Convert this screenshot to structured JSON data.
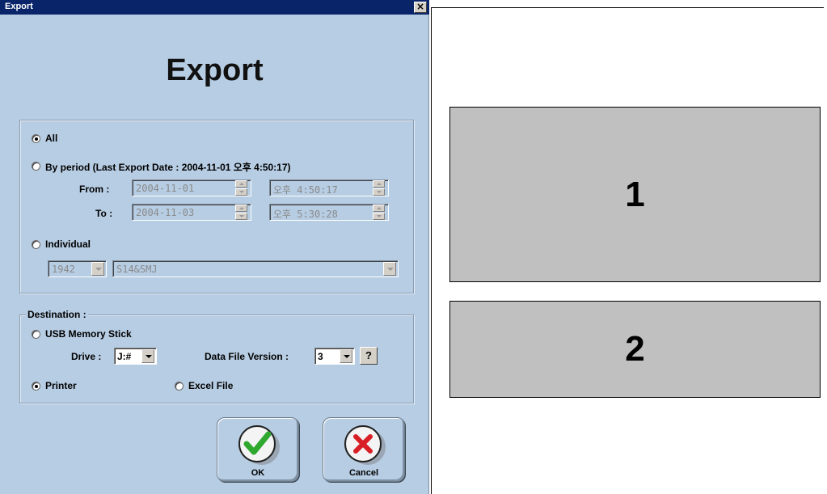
{
  "window": {
    "title": "Export",
    "close_glyph": "×"
  },
  "heading": "Export",
  "range": {
    "all_label": "All",
    "by_period_label": "By period (Last Export Date : 2004-11-01 오후 4:50:17)",
    "from_label": "From :",
    "from_date": "2004-11-01",
    "from_time": "오후  4:50:17",
    "to_label": "To :",
    "to_date": "2004-11-03",
    "to_time": "오후  5:30:28",
    "individual_label": "Individual",
    "individual_id": "1942",
    "individual_name": "S14&SMJ",
    "selected": "All"
  },
  "destination": {
    "legend": "Destination :",
    "usb_label": "USB Memory Stick",
    "drive_label": "Drive :",
    "drive_value": "J:#",
    "version_label": "Data File Version :",
    "version_value": "3",
    "help_label": "?",
    "printer_label": "Printer",
    "excel_label": "Excel File",
    "selected": "Printer"
  },
  "buttons": {
    "ok_label": "OK",
    "cancel_label": "Cancel",
    "ok_icon": "check-icon",
    "cancel_icon": "x-icon"
  },
  "callouts": {
    "box1_label": "1",
    "box2_label": "2"
  },
  "colors": {
    "dialog_bg": "#b7cde3",
    "titlebar": "#0a246a",
    "callout_bg": "#c0c0c0",
    "check_green": "#2fa82f",
    "x_red": "#d91f26"
  }
}
